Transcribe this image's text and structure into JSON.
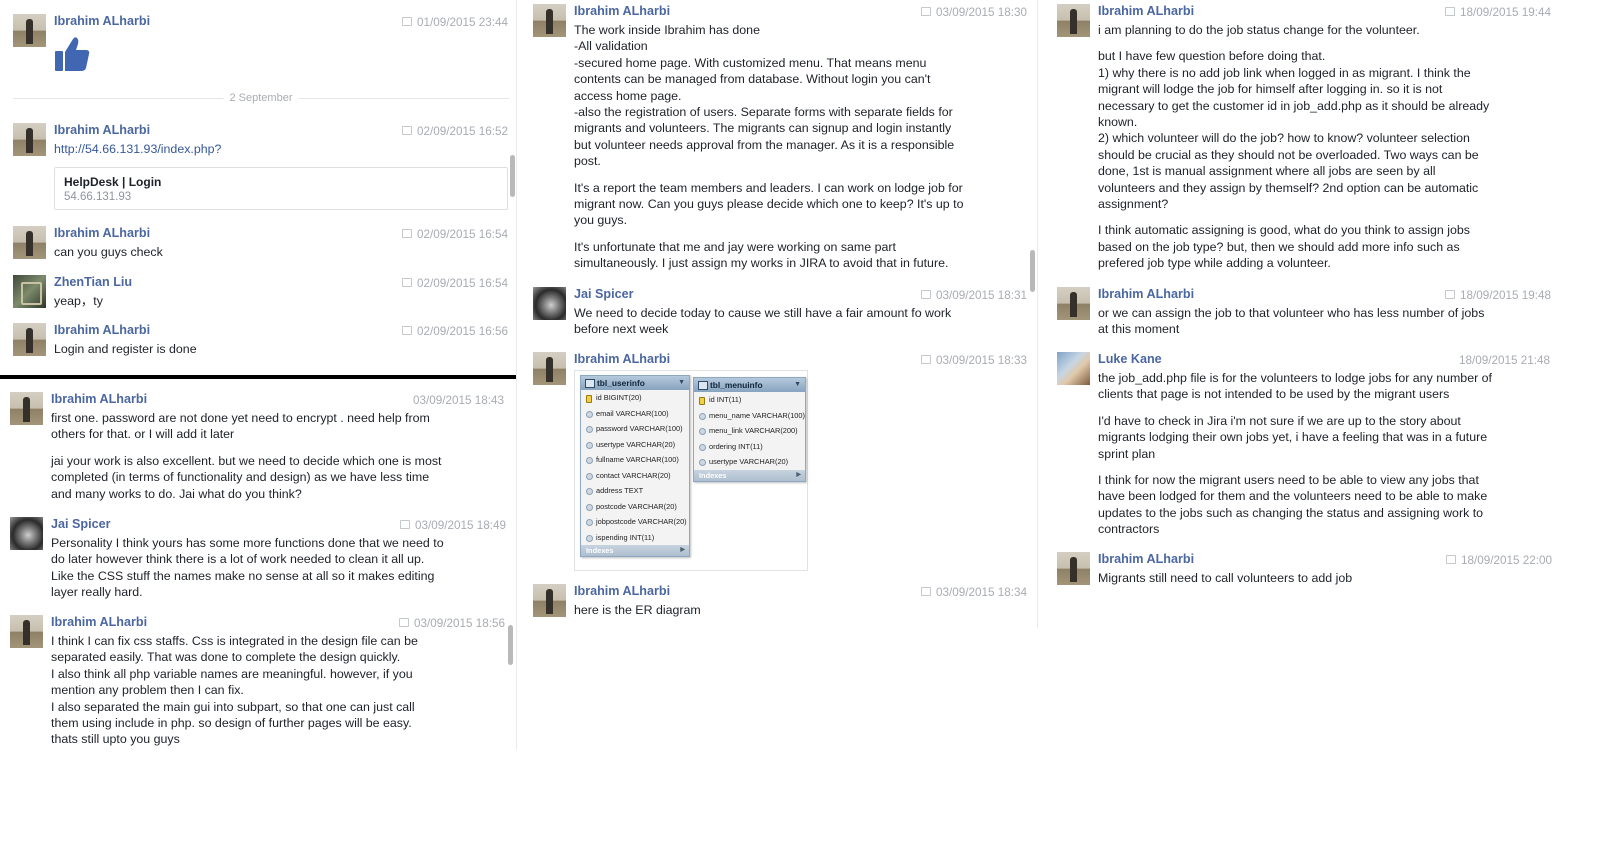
{
  "col1_top": {
    "messages": [
      {
        "avatar": "ibrahim",
        "name": "Ibrahim ALharbi",
        "time": "01/09/2015 23:44",
        "text": ""
      },
      {
        "avatar": "ibrahim",
        "name": "Ibrahim ALharbi",
        "time": "02/09/2015 16:52",
        "link": "http://54.66.131.93/index.php?",
        "card_title": "HelpDesk | Login",
        "card_url": "54.66.131.93"
      },
      {
        "avatar": "ibrahim",
        "name": "Ibrahim ALharbi",
        "time": "02/09/2015 16:54",
        "text": "can you guys check"
      },
      {
        "avatar": "zhentian",
        "name": "ZhenTian Liu",
        "time": "02/09/2015 16:54",
        "text": "yeap，ty"
      },
      {
        "avatar": "ibrahim",
        "name": "Ibrahim ALharbi",
        "time": "02/09/2015 16:56",
        "text": "Login and register is done"
      }
    ],
    "separator": "2 September",
    "thumb_icon": "thumbs-up-icon"
  },
  "col1_bottom": {
    "messages": [
      {
        "avatar": "ibrahim",
        "name": "Ibrahim ALharbi",
        "time": "03/09/2015 18:43",
        "paras": [
          "first one. password are not done yet need to encrypt . need help from\nothers for that. or I will add it later",
          "jai your work is also excellent. but we need to decide which one is most\ncompleted (in terms of functionality and design) as we have less time\nand many works to do. Jai what do you think?"
        ]
      },
      {
        "avatar": "jai",
        "name": "Jai Spicer",
        "time": "03/09/2015 18:49",
        "paras": [
          "Personality I think yours has some more functions done that we need to\ndo later however think there is a lot of work needed to clean it all up.\nLike the CSS stuff the names make no sense at all so it makes editing\nlayer really hard."
        ]
      },
      {
        "avatar": "ibrahim",
        "name": "Ibrahim ALharbi",
        "time": "03/09/2015 18:56",
        "paras": [
          "I think I can fix css staffs. Css is integrated in the design file can be\nseparated easily. That was done to complete the design quickly.\nI also think all php variable names are meaningful. however, if you\nmention any problem then I can fix.\nI also separated the main gui into subpart, so that one can just call\nthem using include in php. so design of further pages will be easy.\nthats still upto you guys"
        ]
      }
    ]
  },
  "col2": {
    "messages": [
      {
        "avatar": "ibrahim",
        "name": "Ibrahim ALharbi",
        "time": "03/09/2015 18:30",
        "paras": [
          "The work inside Ibrahim has done\n-All validation\n-secured home page. With customized menu. That means menu\ncontents can be managed from database. Without login you can't\naccess home page.\n-also the registration of users. Separate forms with separate fields for\nmigrants and volunteers. The migrants can signup and login instantly\nbut volunteer needs approval from the manager. As it is a responsible\npost.",
          "It's a report the team members and leaders. I can work on lodge job for\nmigrant now. Can you guys please decide which one to keep? It's up to\nyou guys.",
          "It's unfortunate that me and jay were working on same part\nsimultaneously. I just assign my works in JIRA to avoid that in future."
        ]
      },
      {
        "avatar": "jai",
        "name": "Jai Spicer",
        "time": "03/09/2015 18:31",
        "paras": [
          "We need to decide today to cause we still have a fair amount fo work\nbefore next week"
        ]
      },
      {
        "avatar": "ibrahim",
        "name": "Ibrahim ALharbi",
        "time": "03/09/2015 18:33",
        "paras": []
      },
      {
        "avatar": "ibrahim",
        "name": "Ibrahim ALharbi",
        "time": "03/09/2015 18:34",
        "paras": [
          "here is the ER diagram"
        ]
      }
    ],
    "er": {
      "userinfo": {
        "title": "tbl_userinfo",
        "cols": [
          "id BIGINT(20)",
          "email VARCHAR(100)",
          "password VARCHAR(100)",
          "usertype VARCHAR(20)",
          "fullname VARCHAR(100)",
          "contact VARCHAR(20)",
          "address TEXT",
          "postcode VARCHAR(20)",
          "jobpostcode VARCHAR(20)",
          "ispending INT(11)"
        ],
        "indexes": "Indexes"
      },
      "menuinfo": {
        "title": "tbl_menuinfo",
        "cols": [
          "id INT(11)",
          "menu_name VARCHAR(100)",
          "menu_link VARCHAR(200)",
          "ordering INT(11)",
          "usertype VARCHAR(20)"
        ],
        "indexes": "Indexes"
      }
    }
  },
  "col3": {
    "messages": [
      {
        "avatar": "ibrahim",
        "name": "Ibrahim ALharbi",
        "time": "18/09/2015 19:44",
        "paras": [
          "i am planning to do the job status change for the volunteer.",
          "but I have few question before doing that.\n1) why there is no add job link when logged in as migrant. I think the\nmigrant will lodge the job for himself after logging in. so it is not\nnecessary to get the customer id in job_add.php as it should be already\nknown.\n2) which volunteer will do the job? how to know? volunteer selection\nshould be crucial as they should not be overloaded. Two ways can be\ndone, 1st is manual assignment where all jobs are seen by all\nvolunteers and they assign by themself? 2nd option can be automatic\nassignment?",
          "I think automatic assigning is good, what do you think to assign jobs\nbased on the job type? but, then we should add more info such as\nprefered job type while adding a volunteer."
        ]
      },
      {
        "avatar": "ibrahim",
        "name": "Ibrahim ALharbi",
        "time": "18/09/2015 19:48",
        "paras": [
          "or we can assign the job to that volunteer who has less number of jobs\nat this moment"
        ]
      },
      {
        "avatar": "luke",
        "name": "Luke Kane",
        "time": "18/09/2015 21:48",
        "paras": [
          "the job_add.php file is for the volunteers to lodge jobs for any number of\nclients that page is not intended to be used by the migrant users",
          "I'd have to check in Jira i'm not sure if we are up to the story about\nmigrants lodging their own jobs yet, i have a feeling that was in a future\nsprint plan",
          "I think for now the migrant users need to be able to view any jobs that\nhave been lodged for them and the volunteers need to be able to make\nupdates to the jobs such as changing the status and assigning work to\ncontractors"
        ]
      },
      {
        "avatar": "ibrahim",
        "name": "Ibrahim ALharbi",
        "time": "18/09/2015 22:00",
        "paras": [
          "Migrants still need to call volunteers to add job"
        ]
      }
    ]
  }
}
